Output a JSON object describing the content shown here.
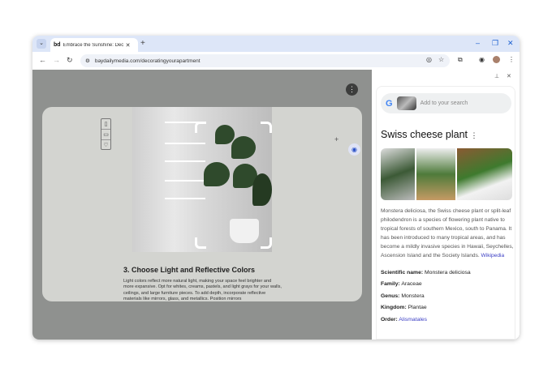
{
  "browser": {
    "tab_title": "Embrace the Sunshine: Deco",
    "tab_logo": "bd",
    "url": "baydailymedia.com/decoratingyourapartment"
  },
  "article": {
    "heading": "3. Choose Light and Reflective Colors",
    "body": "Light colors reflect more natural light, making your space feel brighter and more expansive. Opt for whites, creams, pastels, and light grays for your walls, ceilings, and large furniture pieces. To add depth, incorporate reflective materials like mirrors, glass, and metallics. Position mirrors"
  },
  "panel": {
    "search_placeholder": "Add to your search",
    "title": "Swiss cheese plant",
    "description": "Monstera deliciosa, the Swiss cheese plant or split-leaf philodendron is a species of flowering plant native to tropical forests of southern Mexico, south to Panama. It has been introduced to many tropical areas, and has become a mildly invasive species in Hawaii, Seychelles, Ascension Island and the Society Islands.",
    "source_link": "Wikipedia",
    "facts": [
      {
        "label": "Scientific name:",
        "value": "Monstera deliciosa"
      },
      {
        "label": "Family:",
        "value": "Araceae"
      },
      {
        "label": "Genus:",
        "value": "Monstera"
      },
      {
        "label": "Kingdom:",
        "value": "Plantae"
      },
      {
        "label": "Order:",
        "value": "Alismatales"
      }
    ]
  }
}
